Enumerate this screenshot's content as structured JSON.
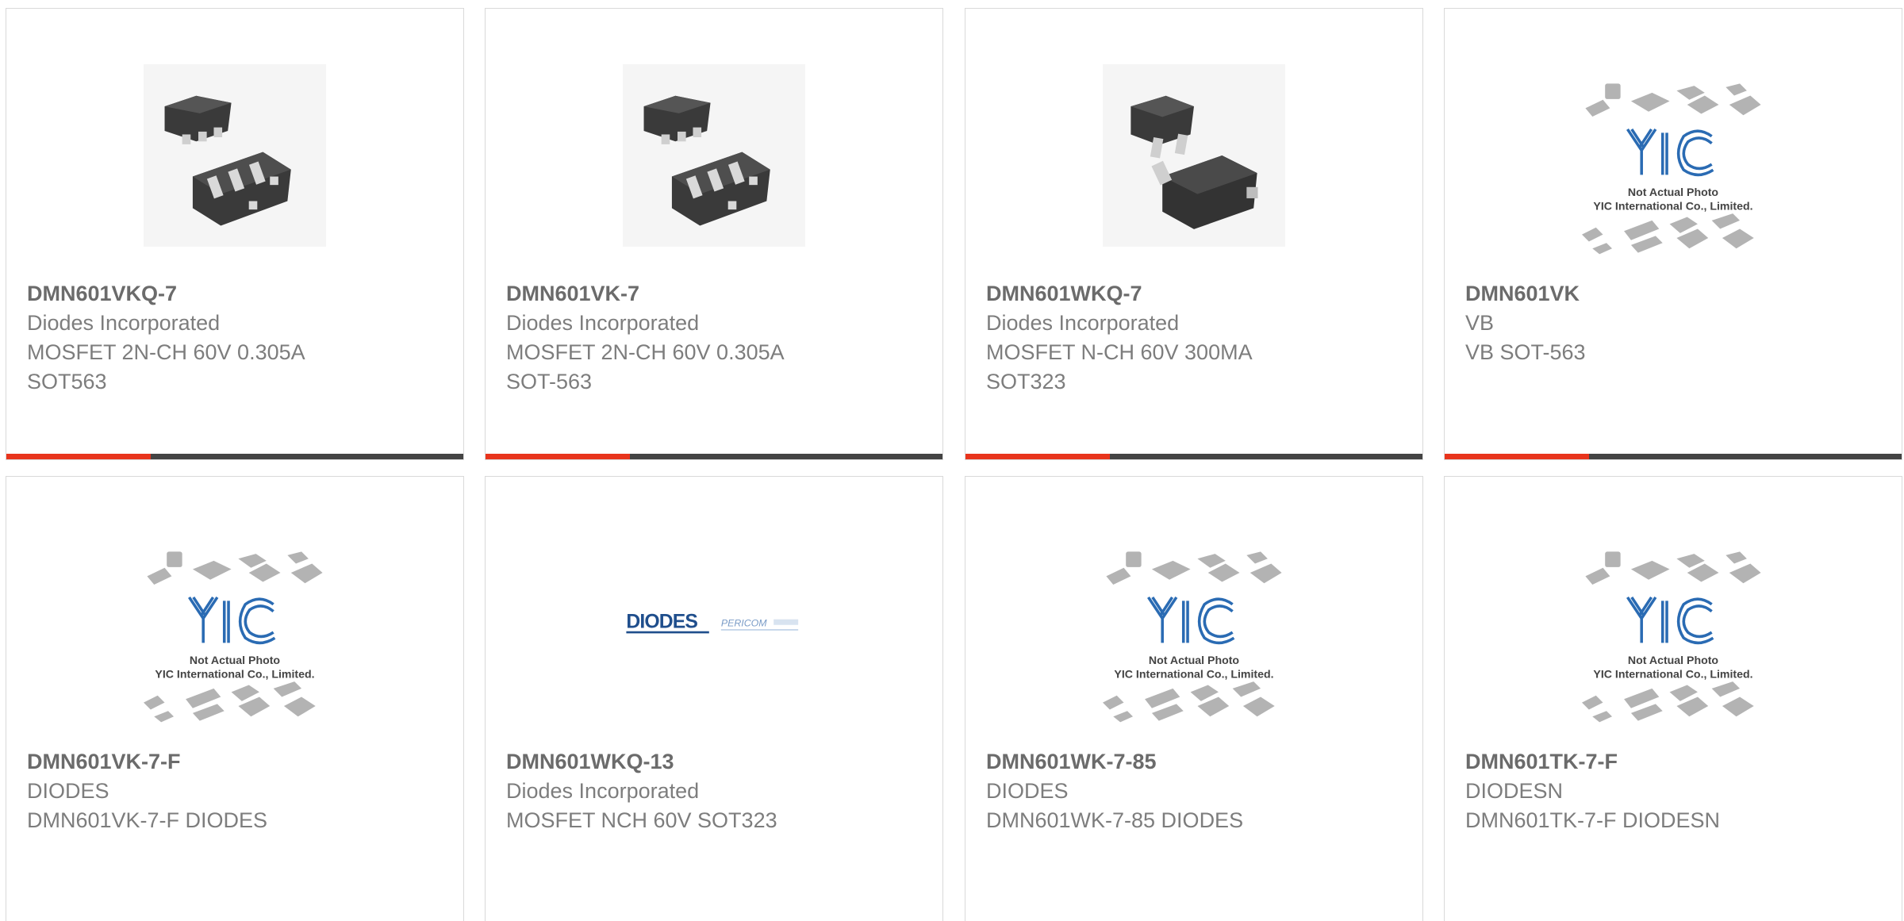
{
  "colors": {
    "accent": "#e8341c",
    "bar_dark": "#444444",
    "title_text": "#6b6b6b",
    "body_text": "#7d7d7d",
    "card_border": "#d9d9d9"
  },
  "products": [
    {
      "part_number": "DMN601VKQ-7",
      "manufacturer": "Diodes Incorporated",
      "description_lines": [
        "MOSFET 2N-CH 60V 0.305A",
        "SOT563"
      ],
      "image_icon": "sot563-package-icon"
    },
    {
      "part_number": "DMN601VK-7",
      "manufacturer": "Diodes Incorporated",
      "description_lines": [
        "MOSFET 2N-CH 60V 0.305A",
        "SOT-563"
      ],
      "image_icon": "sot563-package-icon"
    },
    {
      "part_number": "DMN601WKQ-7",
      "manufacturer": "Diodes Incorporated",
      "description_lines": [
        "MOSFET N-CH 60V 300MA",
        "SOT323"
      ],
      "image_icon": "sot323-package-icon"
    },
    {
      "part_number": "DMN601VK",
      "manufacturer": "VB",
      "description_lines": [
        "VB SOT-563"
      ],
      "image_icon": "placeholder-photo-icon"
    },
    {
      "part_number": "DMN601VK-7-F",
      "manufacturer": "DIODES",
      "description_lines": [
        "DMN601VK-7-F DIODES"
      ],
      "image_icon": "placeholder-photo-icon"
    },
    {
      "part_number": "DMN601WKQ-13",
      "manufacturer": "Diodes Incorporated",
      "description_lines": [
        "MOSFET NCH 60V SOT323"
      ],
      "image_icon": "diodes-pericom-logo-icon"
    },
    {
      "part_number": "DMN601WK-7-85",
      "manufacturer": "DIODES",
      "description_lines": [
        "DMN601WK-7-85 DIODES"
      ],
      "image_icon": "placeholder-photo-icon"
    },
    {
      "part_number": "DMN601TK-7-F",
      "manufacturer": "DIODESN",
      "description_lines": [
        "DMN601TK-7-F DIODESN"
      ],
      "image_icon": "placeholder-photo-icon"
    }
  ],
  "placeholder_image": {
    "brand": "YIC",
    "caption_line1": "Not Actual Photo",
    "caption_line2": "YIC International Co., Limited."
  },
  "logo_image": {
    "brand_left": "DIODES",
    "brand_right": "PERICOM"
  }
}
